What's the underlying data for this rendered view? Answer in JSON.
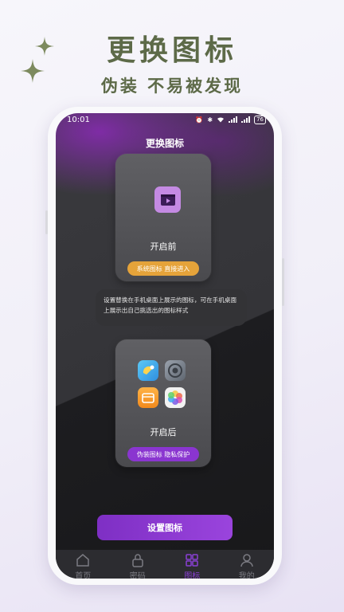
{
  "promo": {
    "title": "更换图标",
    "subtitle": "伪装 不易被发现"
  },
  "status_bar": {
    "time": "10:01",
    "battery": "76"
  },
  "screen": {
    "title": "更换图标",
    "before": {
      "label": "开启前",
      "pill": "系统图标 直接进入"
    },
    "description": "设置替换在手机桌面上展示的图标，可在手机桌面上展示出自己挑选出的图标样式",
    "after": {
      "label": "开启后",
      "pill": "伪装图标 隐私保护"
    },
    "set_button": "设置图标"
  },
  "tabs": [
    {
      "label": "首页",
      "icon": "home-icon"
    },
    {
      "label": "密码",
      "icon": "lock-icon"
    },
    {
      "label": "图标",
      "icon": "grid-icon",
      "active": true
    },
    {
      "label": "我的",
      "icon": "user-icon"
    }
  ],
  "colors": {
    "promo_text": "#5d6a48",
    "accent_purple": "#8a35d0",
    "accent_orange": "#e5a33a",
    "app_icon": "#c48ae3"
  }
}
